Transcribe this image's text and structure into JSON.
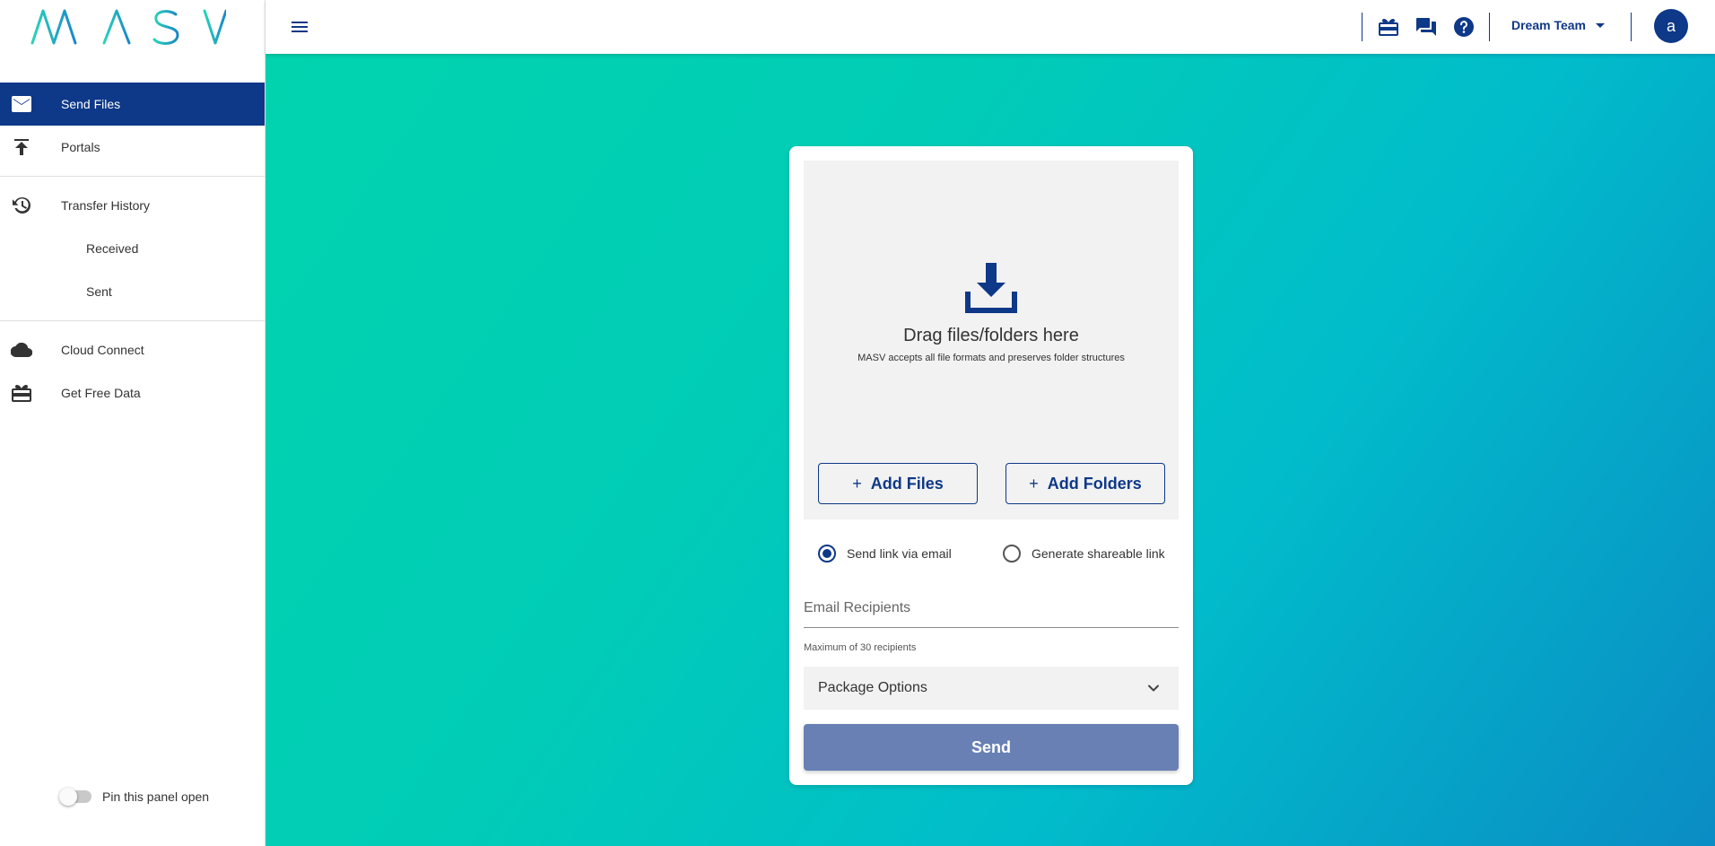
{
  "brand": {
    "logo_text": "MASV"
  },
  "sidebar": {
    "items": [
      {
        "label": "Send Files",
        "icon": "envelope-icon"
      },
      {
        "label": "Portals",
        "icon": "upload-icon"
      },
      {
        "label": "Transfer History",
        "icon": "history-icon"
      },
      {
        "label": "Received"
      },
      {
        "label": "Sent"
      },
      {
        "label": "Cloud Connect",
        "icon": "cloud-icon"
      },
      {
        "label": "Get Free Data",
        "icon": "gift-icon"
      }
    ],
    "pin_label": "Pin this panel open",
    "pin_enabled": false
  },
  "header": {
    "team_name": "Dream Team",
    "avatar_initial": "a",
    "icons": [
      "menu-icon",
      "gift-icon",
      "chat-icon",
      "help-icon",
      "caret-down-icon"
    ]
  },
  "upload": {
    "dropzone_title": "Drag files/folders here",
    "dropzone_subtitle": "MASV accepts all file formats and preserves folder structures",
    "add_files_label": "Add Files",
    "add_folders_label": "Add Folders",
    "delivery_options": [
      {
        "label": "Send link via email",
        "selected": true
      },
      {
        "label": "Generate shareable link",
        "selected": false
      }
    ],
    "email_placeholder": "Email Recipients",
    "email_helper": "Maximum of 30 recipients",
    "package_options_label": "Package Options",
    "send_label": "Send"
  },
  "colors": {
    "primary": "#0e3888",
    "send_disabled": "#6880b4",
    "gradient_start": "#01d3ae",
    "gradient_end": "#0a8cc4",
    "logo_start": "#2ad3b8",
    "logo_end": "#1a86c8"
  }
}
